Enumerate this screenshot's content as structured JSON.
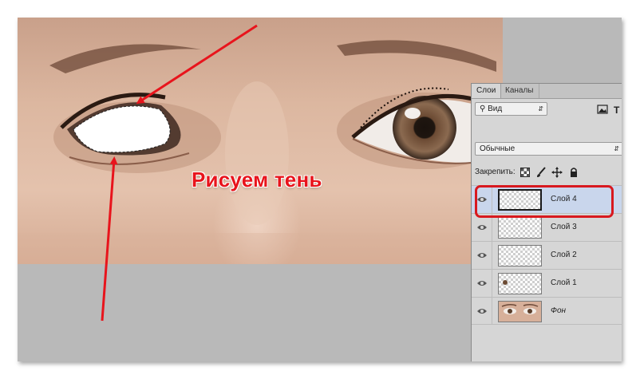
{
  "caption": "Рисуем тень",
  "colors": {
    "accent_red": "#e8141c",
    "panel_bg": "#d6d6d6",
    "selected_row": "#c9d6ec",
    "canvas_gray": "#b9b9b9"
  },
  "layers_panel": {
    "tabs": [
      {
        "label": "Слои",
        "active": true
      },
      {
        "label": "Каналы",
        "active": false
      }
    ],
    "filter_kind": "Вид",
    "blend_mode": "Обычные",
    "lock_label": "Закрепить:",
    "icons": [
      "image-filter-icon",
      "type-filter-icon",
      "lock-transparency-icon",
      "lock-brush-icon",
      "lock-move-icon",
      "lock-all-icon",
      "eye-icon"
    ],
    "layers": [
      {
        "name": "Слой 4",
        "selected": true,
        "italic": false
      },
      {
        "name": "Слой 3",
        "selected": false,
        "italic": false
      },
      {
        "name": "Слой 2",
        "selected": false,
        "italic": false
      },
      {
        "name": "Слой 1",
        "selected": false,
        "italic": false
      },
      {
        "name": "Фон",
        "selected": false,
        "italic": true
      }
    ]
  }
}
